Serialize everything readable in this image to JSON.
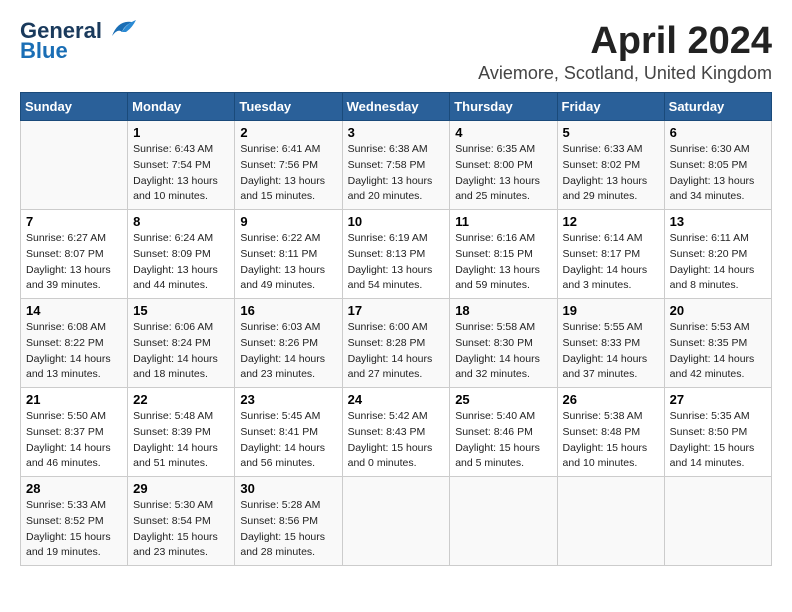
{
  "header": {
    "logo_line1": "General",
    "logo_line2": "Blue",
    "title": "April 2024",
    "subtitle": "Aviemore, Scotland, United Kingdom"
  },
  "weekdays": [
    "Sunday",
    "Monday",
    "Tuesday",
    "Wednesday",
    "Thursday",
    "Friday",
    "Saturday"
  ],
  "weeks": [
    [
      {
        "day": "",
        "sunrise": "",
        "sunset": "",
        "daylight": ""
      },
      {
        "day": "1",
        "sunrise": "Sunrise: 6:43 AM",
        "sunset": "Sunset: 7:54 PM",
        "daylight": "Daylight: 13 hours and 10 minutes."
      },
      {
        "day": "2",
        "sunrise": "Sunrise: 6:41 AM",
        "sunset": "Sunset: 7:56 PM",
        "daylight": "Daylight: 13 hours and 15 minutes."
      },
      {
        "day": "3",
        "sunrise": "Sunrise: 6:38 AM",
        "sunset": "Sunset: 7:58 PM",
        "daylight": "Daylight: 13 hours and 20 minutes."
      },
      {
        "day": "4",
        "sunrise": "Sunrise: 6:35 AM",
        "sunset": "Sunset: 8:00 PM",
        "daylight": "Daylight: 13 hours and 25 minutes."
      },
      {
        "day": "5",
        "sunrise": "Sunrise: 6:33 AM",
        "sunset": "Sunset: 8:02 PM",
        "daylight": "Daylight: 13 hours and 29 minutes."
      },
      {
        "day": "6",
        "sunrise": "Sunrise: 6:30 AM",
        "sunset": "Sunset: 8:05 PM",
        "daylight": "Daylight: 13 hours and 34 minutes."
      }
    ],
    [
      {
        "day": "7",
        "sunrise": "Sunrise: 6:27 AM",
        "sunset": "Sunset: 8:07 PM",
        "daylight": "Daylight: 13 hours and 39 minutes."
      },
      {
        "day": "8",
        "sunrise": "Sunrise: 6:24 AM",
        "sunset": "Sunset: 8:09 PM",
        "daylight": "Daylight: 13 hours and 44 minutes."
      },
      {
        "day": "9",
        "sunrise": "Sunrise: 6:22 AM",
        "sunset": "Sunset: 8:11 PM",
        "daylight": "Daylight: 13 hours and 49 minutes."
      },
      {
        "day": "10",
        "sunrise": "Sunrise: 6:19 AM",
        "sunset": "Sunset: 8:13 PM",
        "daylight": "Daylight: 13 hours and 54 minutes."
      },
      {
        "day": "11",
        "sunrise": "Sunrise: 6:16 AM",
        "sunset": "Sunset: 8:15 PM",
        "daylight": "Daylight: 13 hours and 59 minutes."
      },
      {
        "day": "12",
        "sunrise": "Sunrise: 6:14 AM",
        "sunset": "Sunset: 8:17 PM",
        "daylight": "Daylight: 14 hours and 3 minutes."
      },
      {
        "day": "13",
        "sunrise": "Sunrise: 6:11 AM",
        "sunset": "Sunset: 8:20 PM",
        "daylight": "Daylight: 14 hours and 8 minutes."
      }
    ],
    [
      {
        "day": "14",
        "sunrise": "Sunrise: 6:08 AM",
        "sunset": "Sunset: 8:22 PM",
        "daylight": "Daylight: 14 hours and 13 minutes."
      },
      {
        "day": "15",
        "sunrise": "Sunrise: 6:06 AM",
        "sunset": "Sunset: 8:24 PM",
        "daylight": "Daylight: 14 hours and 18 minutes."
      },
      {
        "day": "16",
        "sunrise": "Sunrise: 6:03 AM",
        "sunset": "Sunset: 8:26 PM",
        "daylight": "Daylight: 14 hours and 23 minutes."
      },
      {
        "day": "17",
        "sunrise": "Sunrise: 6:00 AM",
        "sunset": "Sunset: 8:28 PM",
        "daylight": "Daylight: 14 hours and 27 minutes."
      },
      {
        "day": "18",
        "sunrise": "Sunrise: 5:58 AM",
        "sunset": "Sunset: 8:30 PM",
        "daylight": "Daylight: 14 hours and 32 minutes."
      },
      {
        "day": "19",
        "sunrise": "Sunrise: 5:55 AM",
        "sunset": "Sunset: 8:33 PM",
        "daylight": "Daylight: 14 hours and 37 minutes."
      },
      {
        "day": "20",
        "sunrise": "Sunrise: 5:53 AM",
        "sunset": "Sunset: 8:35 PM",
        "daylight": "Daylight: 14 hours and 42 minutes."
      }
    ],
    [
      {
        "day": "21",
        "sunrise": "Sunrise: 5:50 AM",
        "sunset": "Sunset: 8:37 PM",
        "daylight": "Daylight: 14 hours and 46 minutes."
      },
      {
        "day": "22",
        "sunrise": "Sunrise: 5:48 AM",
        "sunset": "Sunset: 8:39 PM",
        "daylight": "Daylight: 14 hours and 51 minutes."
      },
      {
        "day": "23",
        "sunrise": "Sunrise: 5:45 AM",
        "sunset": "Sunset: 8:41 PM",
        "daylight": "Daylight: 14 hours and 56 minutes."
      },
      {
        "day": "24",
        "sunrise": "Sunrise: 5:42 AM",
        "sunset": "Sunset: 8:43 PM",
        "daylight": "Daylight: 15 hours and 0 minutes."
      },
      {
        "day": "25",
        "sunrise": "Sunrise: 5:40 AM",
        "sunset": "Sunset: 8:46 PM",
        "daylight": "Daylight: 15 hours and 5 minutes."
      },
      {
        "day": "26",
        "sunrise": "Sunrise: 5:38 AM",
        "sunset": "Sunset: 8:48 PM",
        "daylight": "Daylight: 15 hours and 10 minutes."
      },
      {
        "day": "27",
        "sunrise": "Sunrise: 5:35 AM",
        "sunset": "Sunset: 8:50 PM",
        "daylight": "Daylight: 15 hours and 14 minutes."
      }
    ],
    [
      {
        "day": "28",
        "sunrise": "Sunrise: 5:33 AM",
        "sunset": "Sunset: 8:52 PM",
        "daylight": "Daylight: 15 hours and 19 minutes."
      },
      {
        "day": "29",
        "sunrise": "Sunrise: 5:30 AM",
        "sunset": "Sunset: 8:54 PM",
        "daylight": "Daylight: 15 hours and 23 minutes."
      },
      {
        "day": "30",
        "sunrise": "Sunrise: 5:28 AM",
        "sunset": "Sunset: 8:56 PM",
        "daylight": "Daylight: 15 hours and 28 minutes."
      },
      {
        "day": "",
        "sunrise": "",
        "sunset": "",
        "daylight": ""
      },
      {
        "day": "",
        "sunrise": "",
        "sunset": "",
        "daylight": ""
      },
      {
        "day": "",
        "sunrise": "",
        "sunset": "",
        "daylight": ""
      },
      {
        "day": "",
        "sunrise": "",
        "sunset": "",
        "daylight": ""
      }
    ]
  ]
}
